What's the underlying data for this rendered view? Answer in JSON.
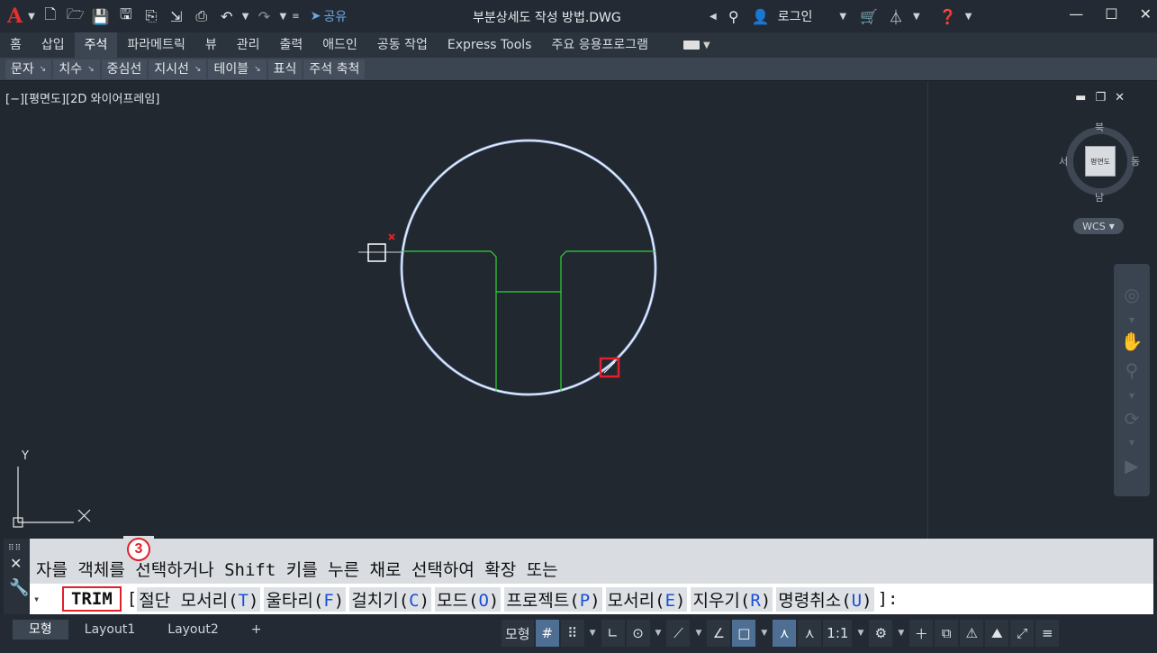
{
  "title_bar": {
    "share_label": "공유",
    "document_title": "부분상세도 작성 방법.DWG",
    "login_label": "로그인",
    "logo_letter": "A"
  },
  "ribbon_tabs": [
    "홈",
    "삽입",
    "주석",
    "파라메트릭",
    "뷰",
    "관리",
    "출력",
    "애드인",
    "공동 작업",
    "Express Tools",
    "주요 응용프로그램"
  ],
  "active_tab": "주석",
  "ribbon_panels": [
    "문자",
    "치수",
    "중심선",
    "지시선",
    "테이블",
    "표식",
    "주석 축척"
  ],
  "viewport": {
    "label": "[−][평면도][2D 와이어프레임]",
    "ucs_y_label": "Y"
  },
  "viewcube": {
    "face": "평면도",
    "north": "북",
    "south": "남",
    "east": "동",
    "west": "서",
    "wcs_label": "WCS"
  },
  "command_line": {
    "history": "자를 객체를 선택하거나 Shift 키를 누른 채로 선택하여 확장 또는",
    "step_badge": "3",
    "command_name": "TRIM",
    "open_bracket": "[",
    "options": [
      {
        "label": "절단 모서리",
        "key": "T"
      },
      {
        "label": "울타리",
        "key": "F"
      },
      {
        "label": "걸치기",
        "key": "C"
      },
      {
        "label": "모드",
        "key": "O"
      },
      {
        "label": "프로젝트",
        "key": "P"
      },
      {
        "label": "모서리",
        "key": "E"
      },
      {
        "label": "지우기",
        "key": "R"
      },
      {
        "label": "명령취소",
        "key": "U"
      }
    ],
    "close_bracket": "]:"
  },
  "layout_tabs": [
    "모형",
    "Layout1",
    "Layout2",
    "+"
  ],
  "status_bar": {
    "model_label": "모형",
    "scale_label": "1:1"
  },
  "colors": {
    "drawing_background": "#212830",
    "circle": "#dfe8f5",
    "lines": "#2fd23a",
    "highlight": "#e1202a",
    "option_key": "#1a4fd6"
  }
}
